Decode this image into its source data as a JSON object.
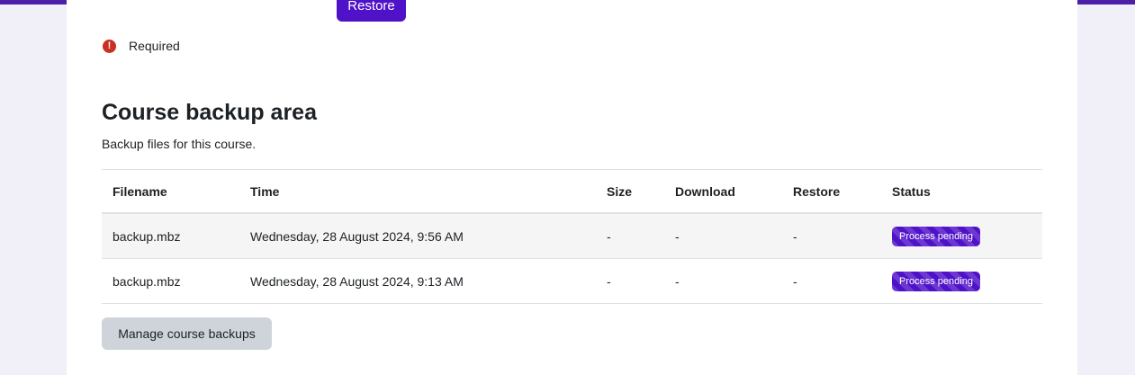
{
  "colors": {
    "accent": "#5012c8",
    "required": "#ca3120",
    "secondary_button": "#ced4da"
  },
  "top": {
    "restore_label": "Restore"
  },
  "required": {
    "icon": "exclamation-circle-icon",
    "label": "Required"
  },
  "section": {
    "title": "Course backup area",
    "description": "Backup files for this course."
  },
  "table": {
    "headers": [
      "Filename",
      "Time",
      "Size",
      "Download",
      "Restore",
      "Status"
    ],
    "rows": [
      {
        "filename": "backup.mbz",
        "time": "Wednesday, 28 August 2024, 9:56 AM",
        "size": "-",
        "download": "-",
        "restore": "-",
        "status": "Process pending"
      },
      {
        "filename": "backup.mbz",
        "time": "Wednesday, 28 August 2024, 9:13 AM",
        "size": "-",
        "download": "-",
        "restore": "-",
        "status": "Process pending"
      }
    ]
  },
  "buttons": {
    "manage": "Manage course backups"
  }
}
